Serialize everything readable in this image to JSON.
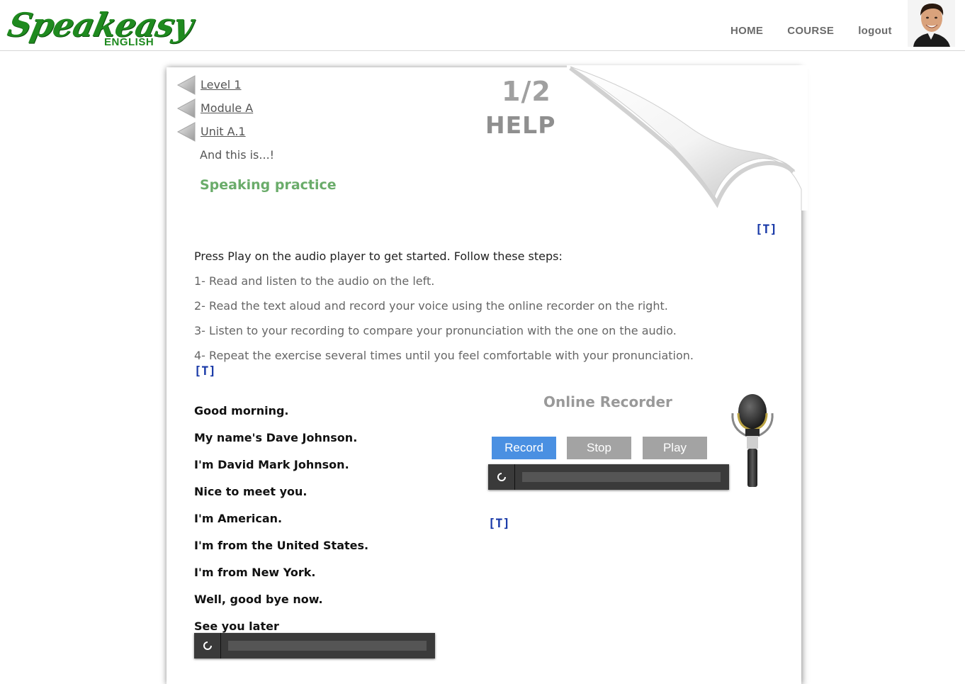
{
  "header": {
    "logo_main": "Speakeasy",
    "logo_sub": "ENGLISH",
    "nav": [
      {
        "label": "HOME"
      },
      {
        "label": "COURSE"
      },
      {
        "label": "logout"
      }
    ]
  },
  "breadcrumbs": [
    {
      "label": "Level 1"
    },
    {
      "label": "Module A"
    },
    {
      "label": "Unit A.1"
    }
  ],
  "intro": "And this is...!",
  "section_title": "Speaking practice",
  "pager": "1/2",
  "help_title": "HELP",
  "translate_label": "[T]",
  "instructions": {
    "lead": "Press Play on the audio player to get started. Follow these steps:",
    "steps": [
      "1- Read and listen to the audio on the left.",
      "2- Read the text aloud and record your voice using the online recorder on the right.",
      "3- Listen to your recording to compare your pronunciation with the one on the audio.",
      "4- Repeat the exercise several times until you feel comfortable with your pronunciation."
    ]
  },
  "dialogue": [
    "Good morning.",
    "My name's Dave Johnson.",
    "I'm David Mark Johnson.",
    "Nice to meet you.",
    "I'm American.",
    "I'm from the United States.",
    "I'm from New York.",
    "Well, good bye now.",
    "See you later"
  ],
  "recorder": {
    "title": "Online Recorder",
    "record_label": "Record",
    "stop_label": "Stop",
    "play_label": "Play"
  },
  "icons": {
    "breadcrumb_arrow": "triangle-left-icon",
    "player_button": "loading-icon",
    "microphone": "microphone-icon"
  },
  "colors": {
    "brand_green": "#1f8a1f",
    "section_green": "#6aac6a",
    "record_blue": "#4a90e2",
    "link_blue": "#1a3aa8"
  }
}
